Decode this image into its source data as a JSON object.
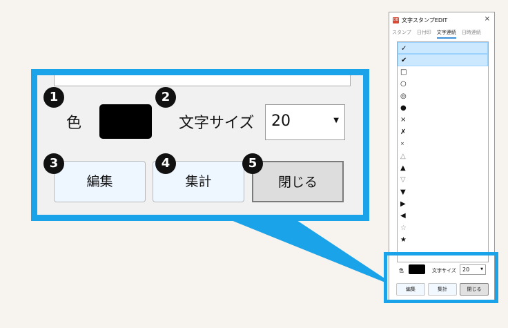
{
  "window": {
    "app_icon_text": "DB",
    "title": "文字スタンプEDIT",
    "close_glyph": "×",
    "tabs": [
      "スタンプ",
      "日付印",
      "文字連続",
      "日時連続"
    ],
    "active_tab_index": 2,
    "list_items": [
      "✓",
      "✔",
      "□",
      "○",
      "◎",
      "●",
      "×",
      "✗",
      "×",
      "△",
      "▲",
      "▽",
      "▼",
      "▶",
      "◀",
      "☆",
      "★"
    ],
    "selected_items": [
      0,
      1
    ]
  },
  "panel": {
    "color_label": "色",
    "color_value": "#000000",
    "size_label": "文字サイズ",
    "size_value": "20",
    "edit_button": "編集",
    "sum_button": "集計",
    "close_button": "閉じる"
  },
  "badges": [
    "1",
    "2",
    "3",
    "4",
    "5"
  ],
  "colors": {
    "accent": "#1aa3e8",
    "badge": "#111111",
    "background": "#f7f3ee"
  },
  "icons": {
    "dropdown": "▼"
  }
}
